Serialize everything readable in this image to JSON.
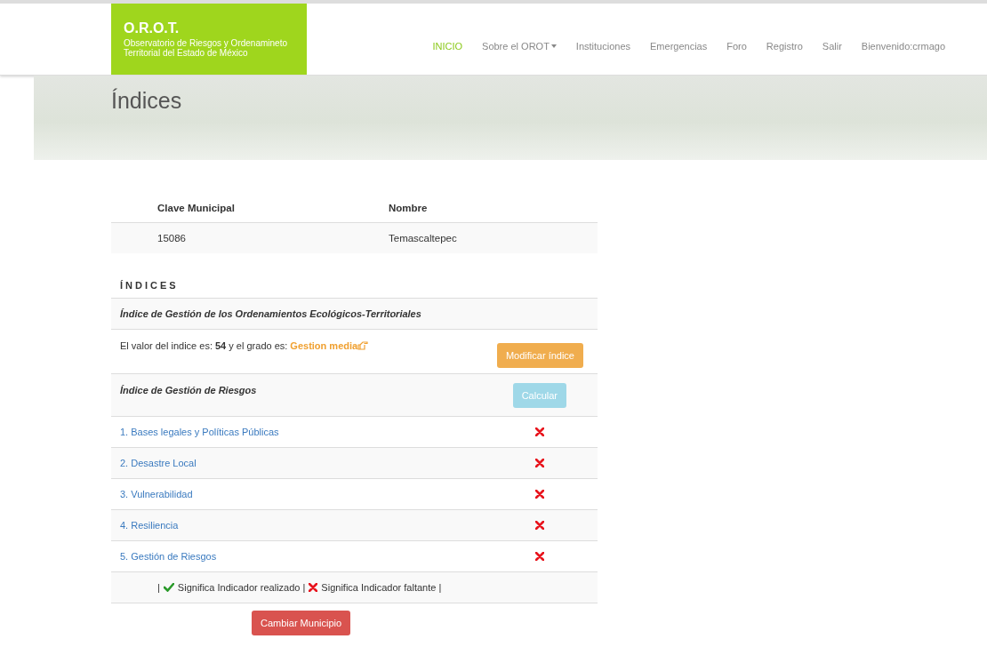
{
  "brand": {
    "title": "O.R.O.T.",
    "subtitle": "Observatorio de Riesgos y Ordenamineto Territorial del Estado de México"
  },
  "nav": [
    {
      "label": "INICIO",
      "selected": true,
      "dropdown": false
    },
    {
      "label": "Sobre el OROT",
      "selected": false,
      "dropdown": true
    },
    {
      "label": "Instituciones",
      "selected": false,
      "dropdown": false
    },
    {
      "label": "Emergencias",
      "selected": false,
      "dropdown": false
    },
    {
      "label": "Foro",
      "selected": false,
      "dropdown": false
    },
    {
      "label": "Registro",
      "selected": false,
      "dropdown": false
    },
    {
      "label": "Salir",
      "selected": false,
      "dropdown": false
    },
    {
      "label": "Bienvenido:crmago",
      "selected": false,
      "dropdown": false
    }
  ],
  "page_title": "Índices",
  "municipio": {
    "columns": [
      "Clave Municipal",
      "Nombre"
    ],
    "row": [
      "15086",
      "Temascaltepec"
    ]
  },
  "section_title": "ÍNDICES",
  "ecological": {
    "title": "Índice de Gestión de los Ordenamientos Ecológicos-Territoriales",
    "value_text": "El valor del indice es: **54** y el grado es:",
    "grade": "Gestion media",
    "button": "Modificar índice"
  },
  "risk": {
    "title": "Índice de Gestión de Riesgos",
    "button": "Calcular",
    "indicators": [
      {
        "label": "1. Bases legales y Políticas Públicas",
        "done": false
      },
      {
        "label": "2. Desastre Local",
        "done": false
      },
      {
        "label": "3. Vulnerabilidad",
        "done": false
      },
      {
        "label": "4. Resiliencia",
        "done": false
      },
      {
        "label": "5. Gestión de Riesgos",
        "done": false
      }
    ]
  },
  "legend": [
    {
      "kind": "text",
      "text": "|"
    },
    {
      "kind": "check"
    },
    {
      "kind": "text",
      "text": "Significa Indicador realizado |"
    },
    {
      "kind": "cross"
    },
    {
      "kind": "text",
      "text": "Significa Indicador faltante |"
    }
  ],
  "change_button": "Cambiar Municipio"
}
